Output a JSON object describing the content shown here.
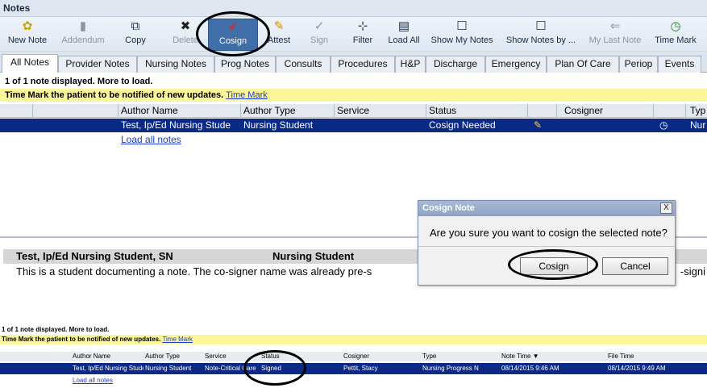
{
  "window": {
    "title": "Notes"
  },
  "toolbar": {
    "new_note": "New Note",
    "addendum": "Addendum",
    "copy": "Copy",
    "delete": "Delete",
    "cosign": "Cosign",
    "attest": "Attest",
    "sign": "Sign",
    "filter": "Filter",
    "load_all": "Load All",
    "show_my_notes": "Show My Notes",
    "show_notes_by": "Show Notes by ...",
    "my_last_note": "My Last Note",
    "time_mark": "Time Mark"
  },
  "tabs": [
    "All Notes",
    "Provider Notes",
    "Nursing Notes",
    "Prog Notes",
    "Consults",
    "Procedures",
    "H&P",
    "Discharge",
    "Emergency",
    "Plan Of Care",
    "Periop",
    "Events"
  ],
  "list": {
    "count_text": "1 of 1 note displayed. More to load.",
    "timemark_text": "Time Mark the patient to be notified of new updates.",
    "timemark_link": "Time Mark",
    "columns": {
      "author_name": "Author Name",
      "author_type": "Author Type",
      "service": "Service",
      "status": "Status",
      "cosigner": "Cosigner",
      "type": "Typ"
    },
    "row": {
      "author_name": "Test, Ip/Ed Nursing Stude",
      "author_type": "Nursing Student",
      "status": "Cosign Needed",
      "type": "Nur"
    },
    "load_all_notes": "Load all notes"
  },
  "preview": {
    "author": "Test, Ip/Ed Nursing Student, SN",
    "author_type": "Nursing Student",
    "body": "This is a student documenting a note.  The co-signer name was already pre-s",
    "tail": "-signi"
  },
  "dialog": {
    "title": "Cosign Note",
    "close": "X",
    "message": "Are you sure you want to cosign the selected note?",
    "ok": "Cosign",
    "cancel": "Cancel"
  },
  "result": {
    "count_text": "1 of 1 note displayed. More to load.",
    "timemark_text": "Time Mark the patient to be notified of new updates.",
    "timemark_link": "Time Mark",
    "columns": {
      "author_name": "Author Name",
      "author_type": "Author Type",
      "service": "Service",
      "status": "Status",
      "cosigner": "Cosigner",
      "type": "Type",
      "note_time": "Note Time ▼",
      "file_time": "File Time"
    },
    "row": {
      "author_name": "Test, Ip/Ed Nursing Stude",
      "author_type": "Nursing Student",
      "service": "Note-Critical Care",
      "status": "Signed",
      "cosigner": "Pettit, Stacy",
      "type": "Nursing Progress N",
      "note_time": "08/14/2015 9:46 AM",
      "file_time": "08/14/2015 9:49 AM"
    },
    "load_all_notes": "Load all notes"
  },
  "colors": {
    "selection": "#0b2a86",
    "timemark_bg": "#fbf59a",
    "link": "#1a3cc8",
    "pressed_button": "#3f6ea8"
  }
}
